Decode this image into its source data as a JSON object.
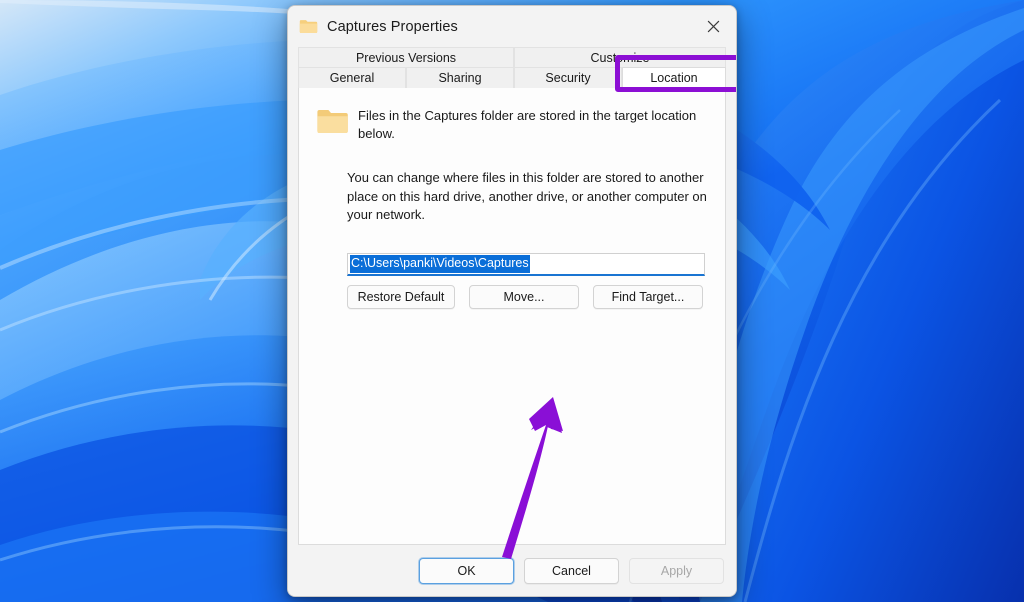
{
  "window": {
    "title": "Captures Properties",
    "title_icon": "folder-icon",
    "close_label": "close-icon"
  },
  "tabs": {
    "row1": [
      {
        "label": "Previous Versions",
        "active": false
      },
      {
        "label": "Customize",
        "active": false
      }
    ],
    "row2": [
      {
        "label": "General",
        "active": false
      },
      {
        "label": "Sharing",
        "active": false
      },
      {
        "label": "Security",
        "active": false
      },
      {
        "label": "Location",
        "active": true
      }
    ],
    "highlighted_tab": "Location"
  },
  "content": {
    "info_icon": "folder-icon",
    "info_text": "Files in the Captures folder are stored in the target location below.",
    "description": "You can change where files in this folder are stored to another place on this hard drive, another drive, or another computer on your network.",
    "path_value": "C:\\Users\\panki\\Videos\\Captures",
    "path_selected": true,
    "buttons": {
      "restore": "Restore Default",
      "move": "Move...",
      "find_target": "Find Target..."
    }
  },
  "footer": {
    "ok": "OK",
    "cancel": "Cancel",
    "apply": "Apply",
    "apply_disabled": true
  },
  "annotations": {
    "highlight_color": "#8c0fd4",
    "arrow_color": "#8a0fd6",
    "arrow_points_to": "Move...",
    "arrow_direction": "up-right"
  },
  "colors": {
    "dialog_bg": "#f3f3f3",
    "panel_bg": "#fdfdfd",
    "selection_blue": "#0a6ed8",
    "focus_blue": "#5aa0e0",
    "folder_yellow": "#f7d184",
    "wallpaper_blue": "#0b5ef0"
  }
}
